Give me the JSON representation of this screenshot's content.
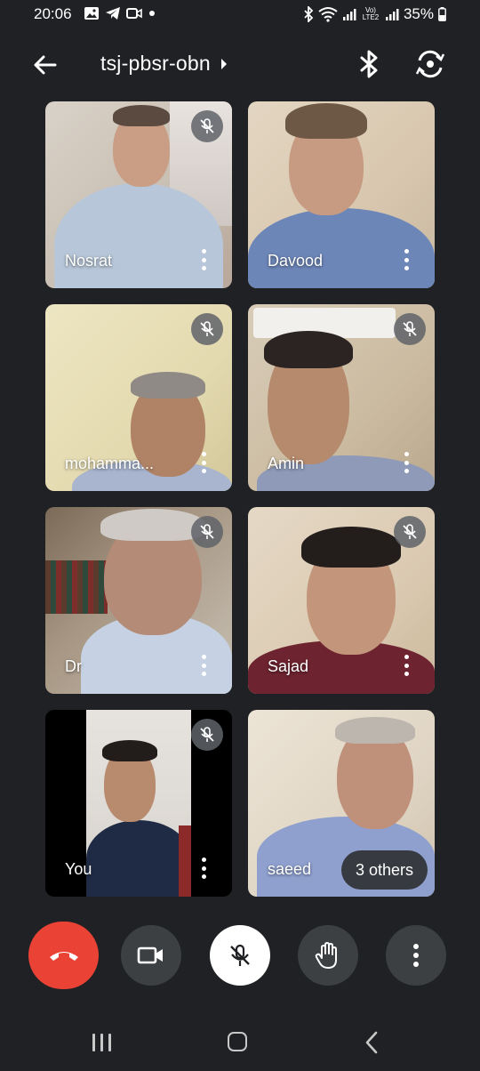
{
  "status_bar": {
    "time": "20:06",
    "battery_percent": "35%",
    "network_label": "Vo) LTE2",
    "icons": [
      "gallery-icon",
      "telegram-icon",
      "video-icon",
      "dot-icon",
      "bluetooth-icon",
      "wifi-icon",
      "signal-icon",
      "signal-icon",
      "battery-icon"
    ]
  },
  "header": {
    "meeting_code": "tsj-pbsr-obn",
    "icons": [
      "back-arrow-icon",
      "chevron-right-icon",
      "bluetooth-audio-icon",
      "switch-camera-icon"
    ]
  },
  "participants": [
    {
      "name": "Nosrat",
      "muted": true
    },
    {
      "name": "Davood",
      "muted": false
    },
    {
      "name": "mohamma...",
      "muted": true
    },
    {
      "name": "Amin",
      "muted": true
    },
    {
      "name": "Dr",
      "muted": true
    },
    {
      "name": "Sajad",
      "muted": true
    },
    {
      "name": "You",
      "muted": true
    },
    {
      "name": "saeed",
      "muted": false
    }
  ],
  "overflow": {
    "label": "3 others"
  },
  "controls": {
    "icons": [
      "hang-up-icon",
      "camera-icon",
      "mic-off-icon",
      "raise-hand-icon",
      "more-options-icon"
    ],
    "hangup_color": "#ea4335"
  },
  "navigation": {
    "icons": [
      "recents-icon",
      "home-icon",
      "back-icon"
    ]
  }
}
